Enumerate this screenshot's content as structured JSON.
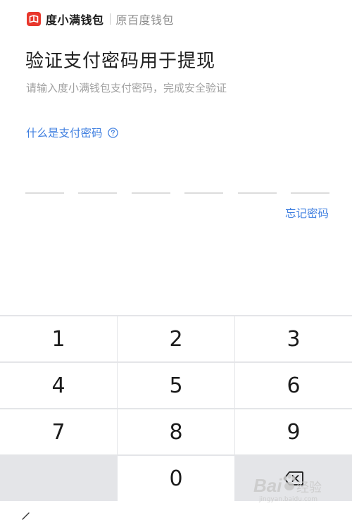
{
  "header": {
    "brand_name": "度小满钱包",
    "brand_sub": "原百度钱包"
  },
  "main": {
    "title": "验证支付密码用于提现",
    "subtitle": "请输入度小满钱包支付密码，完成安全验证",
    "help_link": "什么是支付密码",
    "forgot_link": "忘记密码",
    "pin_length": 6
  },
  "keypad": {
    "keys": [
      "1",
      "2",
      "3",
      "4",
      "5",
      "6",
      "7",
      "8",
      "9",
      "",
      "0",
      "delete"
    ]
  },
  "watermark": {
    "text": "Bai 经验",
    "url": "jingyan.baidu.com"
  },
  "colors": {
    "accent": "#3f7fe0",
    "brand": "#e8372c",
    "keypad_bg": "#e4e5e8"
  }
}
